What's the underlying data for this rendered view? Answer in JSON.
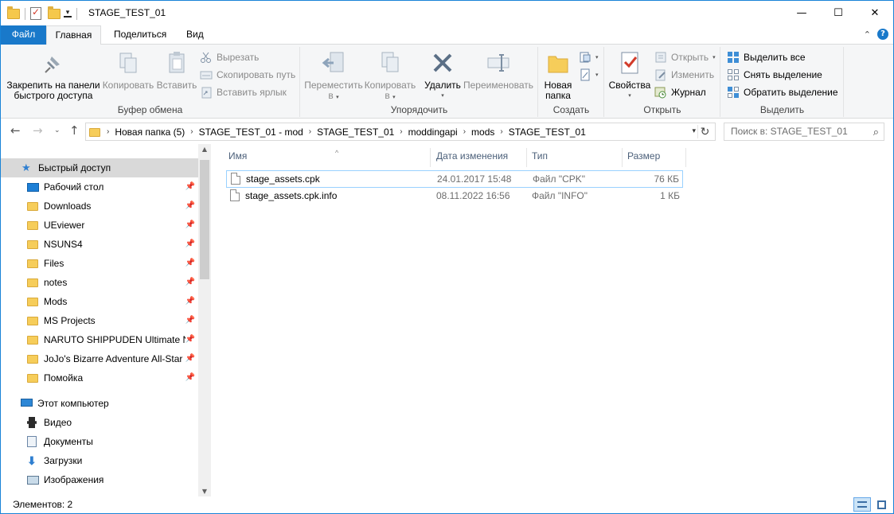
{
  "window": {
    "title": "STAGE_TEST_01",
    "minimize": "—",
    "maximize": "☐",
    "close": "✕"
  },
  "ribbon_tabs": [
    "Файл",
    "Главная",
    "Поделиться",
    "Вид"
  ],
  "ribbon": {
    "clipboard": {
      "label": "Буфер обмена",
      "pin_line1": "Закрепить на панели",
      "pin_line2": "быстрого доступа",
      "copy": "Копировать",
      "paste": "Вставить",
      "cut": "Вырезать",
      "copy_path": "Скопировать путь",
      "paste_shortcut": "Вставить ярлык"
    },
    "organize": {
      "label": "Упорядочить",
      "move_line1": "Переместить",
      "move_line2": "в",
      "copy_line1": "Копировать",
      "copy_line2": "в",
      "delete": "Удалить",
      "rename": "Переименовать"
    },
    "new": {
      "label": "Создать",
      "folder_line1": "Новая",
      "folder_line2": "папка"
    },
    "open": {
      "label": "Открыть",
      "properties": "Свойства",
      "open": "Открыть",
      "edit": "Изменить",
      "history": "Журнал"
    },
    "select": {
      "label": "Выделить",
      "select_all": "Выделить все",
      "select_none": "Снять выделение",
      "invert": "Обратить выделение"
    }
  },
  "address": {
    "crumbs": [
      "Новая папка (5)",
      "STAGE_TEST_01 - mod",
      "STAGE_TEST_01",
      "moddingapi",
      "mods",
      "STAGE_TEST_01"
    ],
    "search_placeholder": "Поиск в: STAGE_TEST_01"
  },
  "nav": {
    "quick_access": "Быстрый доступ",
    "pinned": [
      {
        "label": "Рабочий стол",
        "icon": "desktop-icon"
      },
      {
        "label": "Downloads",
        "icon": "folder-icon"
      },
      {
        "label": "UEviewer",
        "icon": "folder-icon"
      },
      {
        "label": "NSUNS4",
        "icon": "folder-icon"
      },
      {
        "label": "Files",
        "icon": "folder-icon"
      },
      {
        "label": "notes",
        "icon": "folder-icon"
      },
      {
        "label": "Mods",
        "icon": "folder-icon"
      },
      {
        "label": "MS Projects",
        "icon": "folder-icon"
      },
      {
        "label": "NARUTO SHIPPUDEN Ultimate Nin",
        "icon": "folder-icon"
      },
      {
        "label": "JoJo's Bizarre Adventure All-Star B",
        "icon": "folder-icon"
      },
      {
        "label": "Помойка",
        "icon": "folder-icon"
      }
    ],
    "this_pc": "Этот компьютер",
    "pc_items": [
      {
        "label": "Видео",
        "icon": "video-icon"
      },
      {
        "label": "Документы",
        "icon": "documents-icon"
      },
      {
        "label": "Загрузки",
        "icon": "downloads-icon"
      },
      {
        "label": "Изображения",
        "icon": "pictures-icon"
      }
    ]
  },
  "columns": [
    "Имя",
    "Дата изменения",
    "Тип",
    "Размер"
  ],
  "files": [
    {
      "name": "stage_assets.cpk",
      "date": "24.01.2017 15:48",
      "type": "Файл \"CPK\"",
      "size": "76 КБ"
    },
    {
      "name": "stage_assets.cpk.info",
      "date": "08.11.2022 16:56",
      "type": "Файл \"INFO\"",
      "size": "1 КБ"
    }
  ],
  "status": {
    "items_text": "Элементов: 2"
  },
  "colors": {
    "file_tab": "#1979ca",
    "selection": "#d9d9d9",
    "focus_border": "#99d1ff"
  }
}
